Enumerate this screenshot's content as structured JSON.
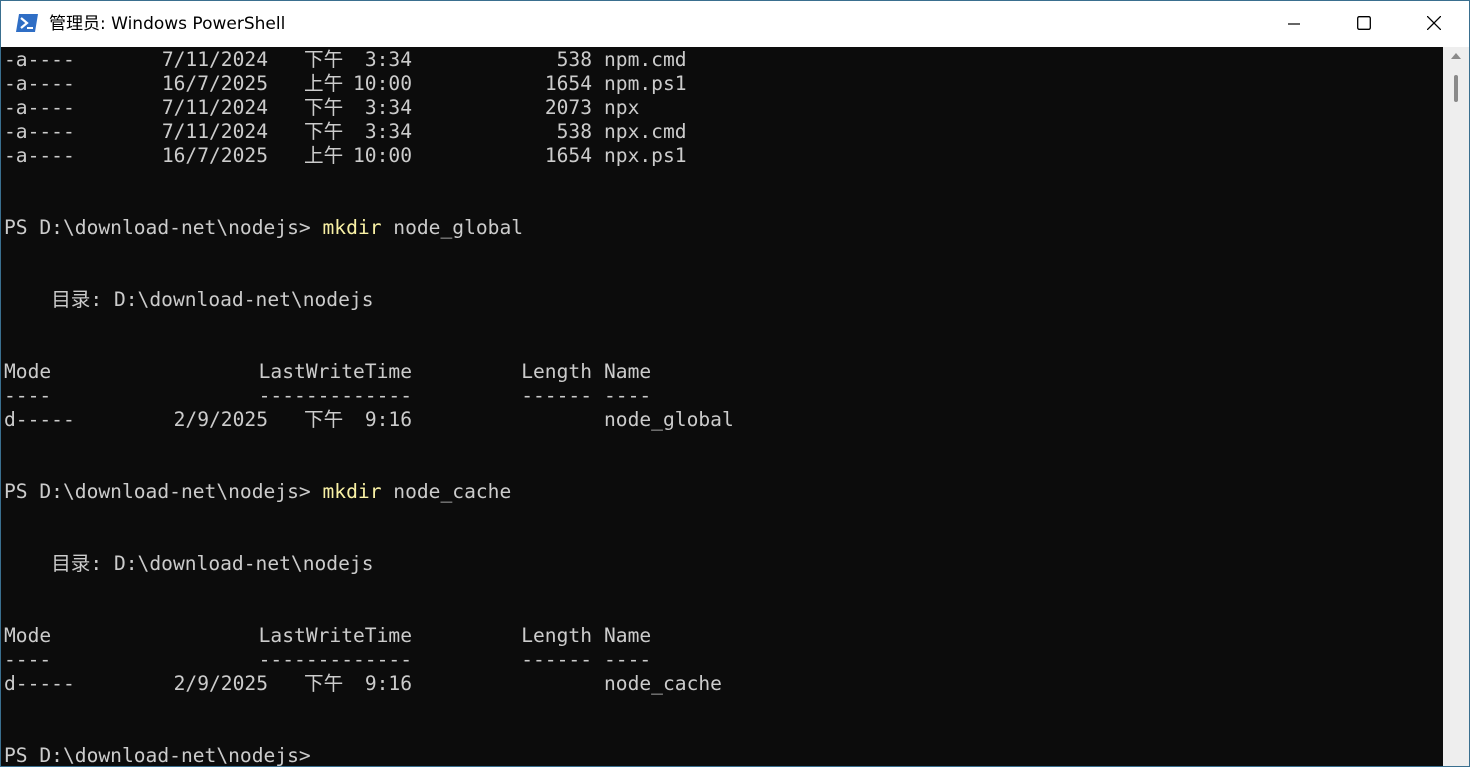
{
  "window": {
    "title": "管理员: Windows PowerShell",
    "icons": {
      "app": "powershell-icon",
      "minimize": "minimize-icon",
      "maximize": "maximize-icon",
      "close": "close-icon"
    }
  },
  "colors": {
    "background": "#0c0c0c",
    "text": "#cccccc",
    "command": "#f9f1a5",
    "titlebar": "#ffffff",
    "icon_accent": "#2f6ec5"
  },
  "console": {
    "prev_listing": [
      {
        "mode": "-a----",
        "date": "7/11/2024",
        "ampm": "下午",
        "time": "3:34",
        "length": "538",
        "name": "npm.cmd"
      },
      {
        "mode": "-a----",
        "date": "16/7/2025",
        "ampm": "上午",
        "time": "10:00",
        "length": "1654",
        "name": "npm.ps1"
      },
      {
        "mode": "-a----",
        "date": "7/11/2024",
        "ampm": "下午",
        "time": "3:34",
        "length": "2073",
        "name": "npx"
      },
      {
        "mode": "-a----",
        "date": "7/11/2024",
        "ampm": "下午",
        "time": "3:34",
        "length": "538",
        "name": "npx.cmd"
      },
      {
        "mode": "-a----",
        "date": "16/7/2025",
        "ampm": "上午",
        "time": "10:00",
        "length": "1654",
        "name": "npx.ps1"
      }
    ],
    "prompt": "PS D:\\download-net\\nodejs>",
    "directory_label": "目录:",
    "directory_path": "D:\\download-net\\nodejs",
    "headers": {
      "mode": "Mode",
      "last_write_time": "LastWriteTime",
      "length": "Length",
      "name": "Name",
      "mode_rule": "----",
      "last_write_time_rule": "-------------",
      "length_rule": "------",
      "name_rule": "----"
    },
    "commands": [
      {
        "keyword": "mkdir",
        "arg": "node_global",
        "entry": {
          "mode": "d-----",
          "date": "2/9/2025",
          "ampm": "下午",
          "time": "9:16",
          "length": "",
          "name": "node_global"
        }
      },
      {
        "keyword": "mkdir",
        "arg": "node_cache",
        "entry": {
          "mode": "d-----",
          "date": "2/9/2025",
          "ampm": "下午",
          "time": "9:16",
          "length": "",
          "name": "node_cache"
        }
      }
    ]
  }
}
